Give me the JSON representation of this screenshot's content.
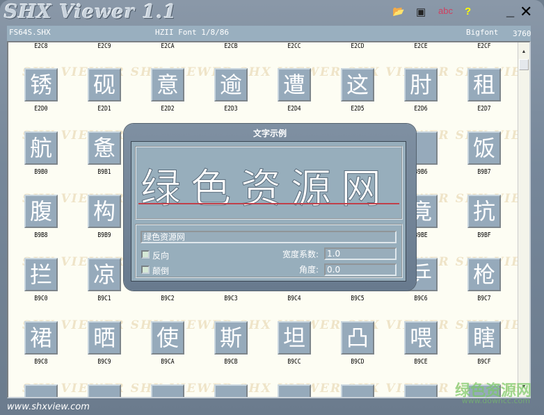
{
  "app": {
    "title": "SHX Viewer 1.1",
    "url": "www.shxview.com"
  },
  "toolbar": {
    "abc_label": "abc",
    "help_label": "?"
  },
  "header": {
    "file": "FS64S.SHX",
    "font_desc": "HZII Font 1/8/86",
    "type": "Bigfont",
    "count": "3760"
  },
  "watermark": "SHX VIEWER  SHX VIEWER  SHX VIEWER  SHX VIEWER  SHX VIEWER",
  "top_labels": [
    "E2C8",
    "E2C9",
    "E2CA",
    "E2CB",
    "E2CC",
    "E2CD",
    "E2CE",
    "E2CF"
  ],
  "rows": [
    {
      "chars": [
        "锈",
        "砚",
        "意",
        "逾",
        "遭",
        "这",
        "肘",
        "租"
      ],
      "codes": [
        "E2D0",
        "E2D1",
        "E2D2",
        "E2D3",
        "E2D4",
        "E2D5",
        "E2D6",
        "E2D7"
      ]
    },
    {
      "chars": [
        "航",
        "惫",
        "",
        "",
        "",
        "",
        "",
        "饭"
      ],
      "codes": [
        "B9B0",
        "B9B1",
        "",
        "",
        "",
        "",
        "B9B6",
        "B9B7"
      ]
    },
    {
      "chars": [
        "腹",
        "构",
        "",
        "",
        "",
        "",
        "竟",
        "抗"
      ],
      "codes": [
        "B9B8",
        "B9B9",
        "",
        "",
        "",
        "",
        "B9BE",
        "B9BF"
      ]
    },
    {
      "chars": [
        "拦",
        "凉",
        "",
        "",
        "",
        "",
        "乒",
        "枪"
      ],
      "codes": [
        "B9C0",
        "B9C1",
        "B9C2",
        "B9C3",
        "B9C4",
        "B9C5",
        "B9C6",
        "B9C7"
      ]
    },
    {
      "chars": [
        "裙",
        "晒",
        "使",
        "斯",
        "坦",
        "凸",
        "喂",
        "瞎"
      ],
      "codes": [
        "B9C8",
        "B9C9",
        "B9CA",
        "B9CB",
        "B9CC",
        "B9CD",
        "B9CE",
        "B9CF"
      ]
    },
    {
      "chars": [
        "",
        "",
        "",
        "",
        "",
        "",
        "",
        ""
      ],
      "codes": [
        "",
        "",
        "",
        "",
        "",
        "",
        "",
        ""
      ]
    }
  ],
  "dialog": {
    "title": "文字示例",
    "preview_text": "绿色资源网",
    "input_value": "绿色资源网",
    "reverse_label": "反向",
    "upside_down_label": "颠倒",
    "width_label": "宽度系数:",
    "width_value": "1.0",
    "angle_label": "角度:",
    "angle_value": "0.0"
  },
  "site_watermark": {
    "name": "绿色资源网",
    "url": "www.downcc.com"
  }
}
